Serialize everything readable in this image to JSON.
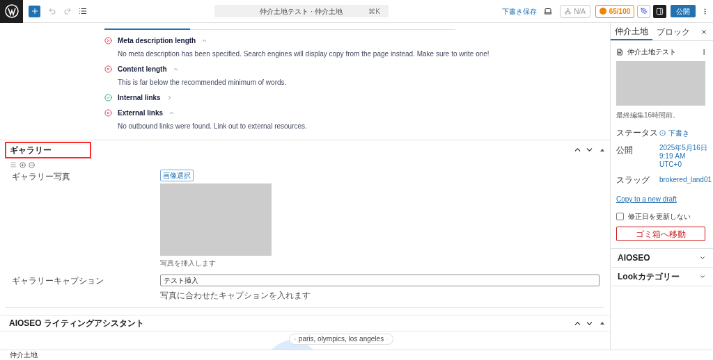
{
  "toolbar": {
    "command_title": "仲介土地テスト · 仲介土地",
    "shortcut": "⌘K",
    "save_draft": "下書き保存",
    "na_label": "N/A",
    "score": "65/100",
    "publish": "公開",
    "sidebar_open": true
  },
  "seo_checks": [
    {
      "kind": "error",
      "title": "Meta description length",
      "expanded": true,
      "description": "No meta description has been specified. Search engines will display copy from the page instead. Make sure to write one!"
    },
    {
      "kind": "error",
      "title": "Content length",
      "expanded": true,
      "description": "This is far below the recommended minimum of words."
    },
    {
      "kind": "ok",
      "title": "Internal links",
      "expanded": false
    },
    {
      "kind": "error",
      "title": "External links",
      "expanded": true,
      "description": "No outbound links were found. Link out to external resources."
    }
  ],
  "gallery": {
    "title": "ギャラリー",
    "highlighted": true,
    "fields": [
      {
        "kind": "image",
        "label": "ギャラリー写真",
        "button": "画像選択",
        "hint": "写真を挿入します"
      },
      {
        "kind": "text",
        "label": "ギャラリーキャプション",
        "value": "テスト挿入",
        "hint": "写真に合わせたキャプションを入れます"
      }
    ]
  },
  "writing_assistant": {
    "title": "AIOSEO ライティングアシスタント",
    "search_value": "paris, olympics, los angeles"
  },
  "breadcrumb": "仲介土地",
  "sidebar": {
    "tabs": [
      {
        "label": "仲介土地",
        "selected": true
      },
      {
        "label": "ブロック",
        "selected": false
      }
    ],
    "post_title": "仲介土地テスト",
    "last_edited": "最終編集16時間前。",
    "rows": [
      {
        "label": "ステータス",
        "value": "下書き",
        "kind": "status"
      },
      {
        "label": "公開",
        "value": "2025年5月16日\n9:19 AM UTC+0",
        "kind": "link"
      },
      {
        "label": "スラッグ",
        "value": "brokered_land01",
        "kind": "link"
      }
    ],
    "copy_link": "Copy to a new draft",
    "checkbox": {
      "label": "修正日を更新しない",
      "checked": false
    },
    "trash": "ゴミ箱へ移動",
    "panels": [
      {
        "title": "AIOSEO",
        "expanded": false
      },
      {
        "title": "Lookカテゴリー",
        "expanded": false
      }
    ]
  }
}
